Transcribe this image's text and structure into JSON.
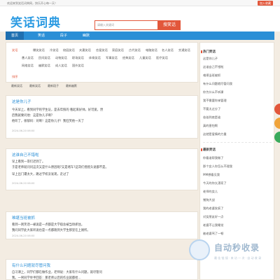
{
  "topbar": {
    "welcome": "欢迎来到笑话词典网，快乐开心每一天！",
    "favorite": "加入收藏"
  },
  "header": {
    "logo": "笑话词典",
    "search_placeholder": "请输入关键词",
    "search_button": "搜笑话"
  },
  "nav": {
    "tabs": [
      "首页",
      "笑话",
      "段子",
      "幽默"
    ]
  },
  "filters": {
    "label": "笑话",
    "row1": [
      "爆笑笑话",
      "冷笑话",
      "校园笑话",
      "夫妻笑话",
      "恋爱笑话",
      "家庭笑话",
      "古代笑话",
      "电脑笑话",
      "名人笑话",
      "交通笑话"
    ],
    "row2": [
      "愚人笑话",
      "民间笑话",
      "动物笑话",
      "职场笑话",
      "体育笑话",
      "军事笑话",
      "经典笑话",
      "儿童笑话",
      "医疗笑话"
    ],
    "row3": [
      "网络笑话",
      "幽默笑话",
      "成人笑话",
      "国外笑话"
    ],
    "label2": "排序"
  },
  "sort": [
    "最新笑话",
    "最新笑话",
    "最新段子",
    "最新幽默"
  ],
  "cards": [
    {
      "title": "这是你儿子",
      "lines": [
        "今天早上，看到同学的学生证，是去年照的 看起来好帅，好可爱，然",
        "后我就要问他：这是你儿子啊？",
        "他听了，很郁闷：对啊！这是你儿子！我狂笑他一天了"
      ],
      "meta": "2024-06-20 06:00"
    },
    {
      "title": "这谁自己不错啦",
      "lines": [
        "早上看到一哥们迟到了。",
        "于是老师就问问这次又是什么原因呢?又是堵车?这哥们摇摇头说都不是。",
        "早上出门遭太大，路过学校没发现，走过了"
      ],
      "meta": "2024-06-20 06:00"
    },
    {
      "title": "难堪当班被抓",
      "lines": [
        "看到一则笑话一被说是一点都是大学宿舍被当场抓住。",
        "我问同学此大家听说也是一点都跑到大学生那里在上厕所。"
      ],
      "meta": "2024-06-20 06:00"
    },
    {
      "title": "有什么问题就尽管问我",
      "lines": [
        "自习课上，同学们都在做作业，老师说：大家有什么问题，就尽管问",
        "我。一男同学举手回答：那老师以后的作业就都给..."
      ],
      "meta": ""
    }
  ],
  "sidebar": {
    "hot_title": "热门笑话",
    "hot_items": [
      "这是你儿子",
      "这谁自己不错啦",
      "难堪当班被抓",
      "有什么问题就尽管问我",
      "你为什么不听课",
      "我不需要你来管理",
      "不要太过分了",
      "爸爸到底是谁",
      "真的害怕啊",
      "这就是爱情的力量"
    ],
    "new_title": "最新笑话",
    "new_items": [
      "你看谁帮我做了",
      "那个女人你怎么不理我",
      "MM想看见我",
      "今天的你太漂亮了",
      "老师的女儿",
      "猪狗大战",
      "我的老婆发疯了",
      "对女朋友好一点",
      "老婆不让我睡觉",
      "被老婆骂了一顿"
    ]
  },
  "watermark": {
    "text": "自动秒收录",
    "sub": "最 佳 链 接 · 来 访 一 次 · 自 动 收 录"
  },
  "colors": {
    "brand": "#2c9be2",
    "accent": "#e2573b",
    "nav": "#2b8fd6",
    "background": "#f3ece2"
  }
}
